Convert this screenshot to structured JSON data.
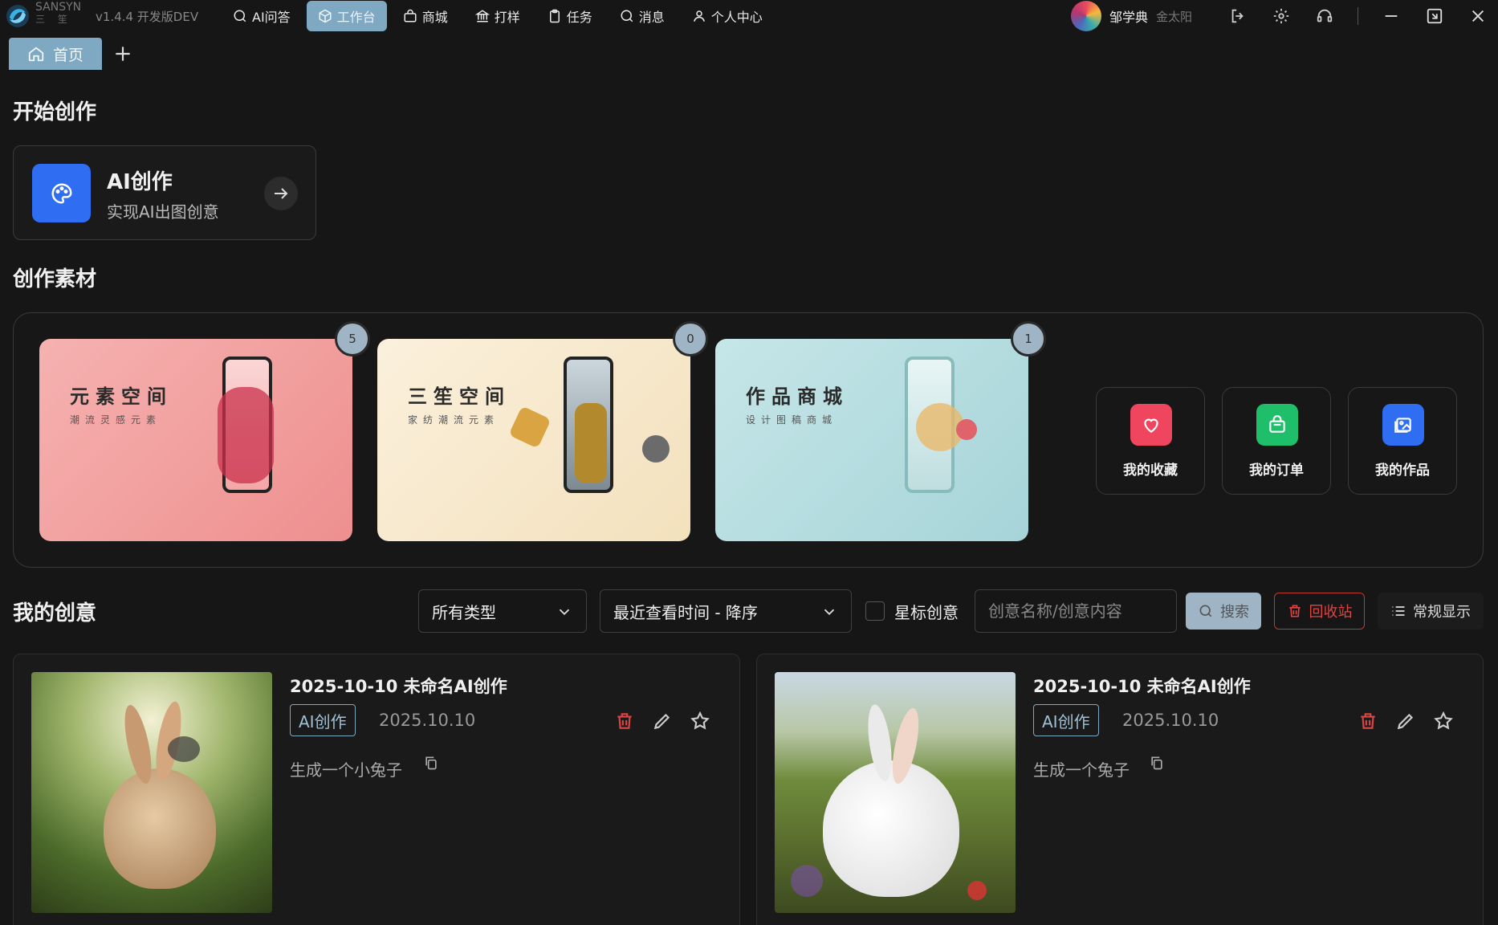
{
  "app": {
    "brand": "SANSYN",
    "brand_sub": "三 笙",
    "version": "v1.4.4 开发版DEV"
  },
  "nav": [
    {
      "label": "AI问答",
      "icon": "chat-icon",
      "active": false
    },
    {
      "label": "工作台",
      "icon": "cube-icon",
      "active": true
    },
    {
      "label": "商城",
      "icon": "bag-icon",
      "active": false
    },
    {
      "label": "打样",
      "icon": "bank-icon",
      "active": false
    },
    {
      "label": "任务",
      "icon": "clipboard-icon",
      "active": false
    },
    {
      "label": "消息",
      "icon": "message-icon",
      "active": false
    },
    {
      "label": "个人中心",
      "icon": "user-icon",
      "active": false
    }
  ],
  "user": {
    "name": "邹学典",
    "org": "金太阳"
  },
  "tabs": {
    "home_label": "首页"
  },
  "sections": {
    "start_title": "开始创作",
    "material_title": "创作素材",
    "ideas_title": "我的创意"
  },
  "ai_card": {
    "title": "AI创作",
    "subtitle": "实现AI出图创意"
  },
  "materials": [
    {
      "title": "元素空间",
      "subtitle": "潮流灵感元素",
      "count": "5",
      "bg": "#f2a3a3"
    },
    {
      "title": "三笙空间",
      "subtitle": "家纺潮流元素",
      "count": "0",
      "bg": "#f7ead0"
    },
    {
      "title": "作品商城",
      "subtitle": "设计图稿商城",
      "count": "1",
      "bg": "#b9dfe2"
    }
  ],
  "quick_links": [
    {
      "label": "我的收藏",
      "icon": "heart-icon",
      "color": "#f0455f"
    },
    {
      "label": "我的订单",
      "icon": "shopping-bag-icon",
      "color": "#1ebe6a"
    },
    {
      "label": "我的作品",
      "icon": "gallery-icon",
      "color": "#2f6ef2"
    }
  ],
  "filters": {
    "type_value": "所有类型",
    "sort_value": "最近查看时间 - 降序",
    "starred_label": "星标创意",
    "search_placeholder": "创意名称/创意内容",
    "search_button": "搜索",
    "recycle_button": "回收站",
    "view_button": "常规显示"
  },
  "ideas": [
    {
      "title": "2025-10-10 未命名AI创作",
      "tag": "AI创作",
      "date": "2025.10.10",
      "desc": "生成一个小兔子"
    },
    {
      "title": "2025-10-10 未命名AI创作",
      "tag": "AI创作",
      "date": "2025.10.10",
      "desc": "生成一个兔子"
    }
  ]
}
